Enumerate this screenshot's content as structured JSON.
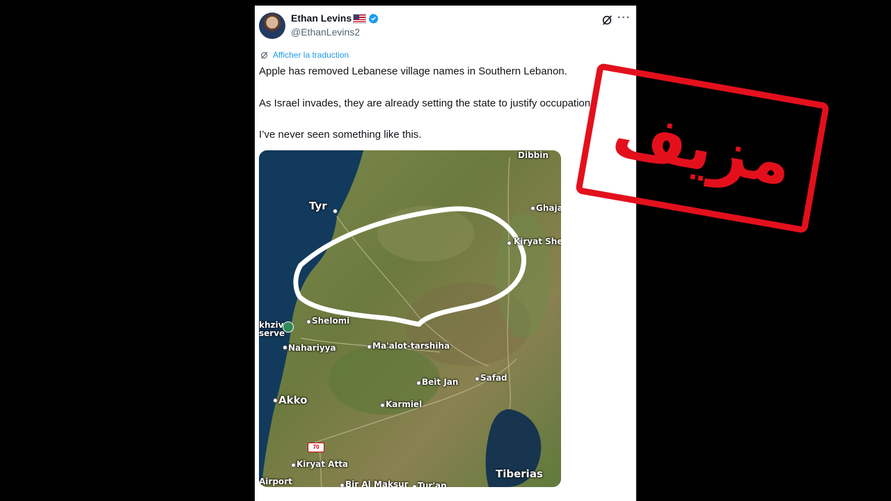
{
  "tweet": {
    "author_name": "Ethan Levins",
    "handle": "@EthanLevins2",
    "translate_label": "Afficher la traduction",
    "line1": "Apple has removed Lebanese village names in Southern Lebanon.",
    "line2": "As Israel invades, they are already setting the state to justify occupation.",
    "line3": "I’ve never seen something like this."
  },
  "map": {
    "labels": {
      "tyr": "Tyr",
      "ghaja": "Ghaja",
      "kiryat_shem": "Kiryat Shem",
      "shelomi": "Shelomi",
      "akhziv_1": "khziv",
      "akhziv_2": "serve",
      "nahariyya": "Nahariyya",
      "maalot": "Ma'alot-tarshiha",
      "beit_jan": "Beit Jan",
      "safad": "Safad",
      "akko": "Akko",
      "karmiel": "Karmiel",
      "kiryat_atta": "Kiryat Atta",
      "tiberias": "Tiberias",
      "airport": "Airport",
      "bir_al_maksur": "Bir Al Maksur",
      "turan": "Tur'an",
      "dibbin": "Dibbin",
      "road_70": "70"
    }
  },
  "stamp": {
    "text": "مزيف"
  },
  "colors": {
    "accent": "#1d9bf0",
    "stamp": "#e3101c"
  }
}
